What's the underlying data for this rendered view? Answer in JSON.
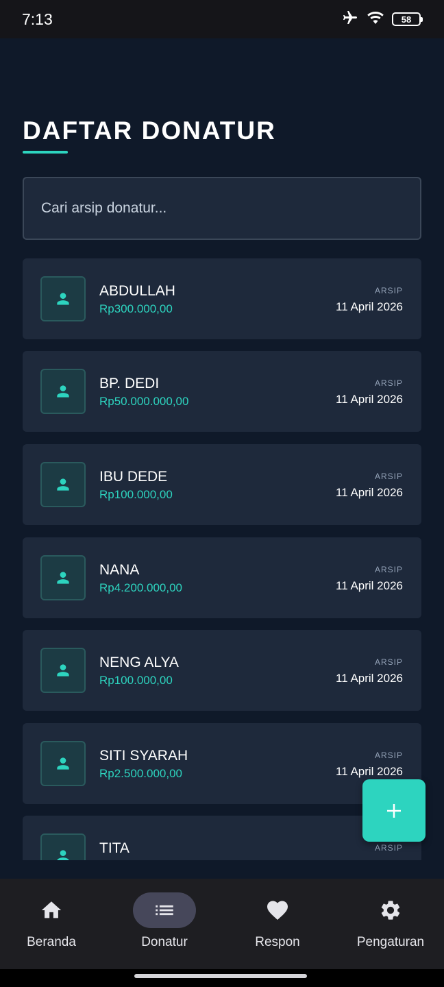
{
  "status_bar": {
    "time": "7:13",
    "battery": "58",
    "icons": [
      "airplane-icon",
      "wifi-icon",
      "battery-icon"
    ]
  },
  "page": {
    "title": "DAFTAR DONATUR",
    "accent_color": "#2dd4bf"
  },
  "search": {
    "placeholder": "Cari arsip donatur...",
    "value": ""
  },
  "donors": [
    {
      "name": "ABDULLAH",
      "amount": "Rp300.000,00",
      "label": "ARSIP",
      "date": "11 April 2026"
    },
    {
      "name": "BP. DEDI",
      "amount": "Rp50.000.000,00",
      "label": "ARSIP",
      "date": "11 April 2026"
    },
    {
      "name": "IBU DEDE",
      "amount": "Rp100.000,00",
      "label": "ARSIP",
      "date": "11 April 2026"
    },
    {
      "name": "NANA",
      "amount": "Rp4.200.000,00",
      "label": "ARSIP",
      "date": "11 April 2026"
    },
    {
      "name": "NENG ALYA",
      "amount": "Rp100.000,00",
      "label": "ARSIP",
      "date": "11 April 2026"
    },
    {
      "name": "SITI SYARAH",
      "amount": "Rp2.500.000,00",
      "label": "ARSIP",
      "date": "11 April 2026"
    },
    {
      "name": "TITA",
      "amount": "",
      "label": "ARSIP",
      "date": ""
    }
  ],
  "fab": {
    "icon": "plus-icon"
  },
  "bottom_nav": [
    {
      "label": "Beranda",
      "icon": "home-icon",
      "active": false
    },
    {
      "label": "Donatur",
      "icon": "list-icon",
      "active": true
    },
    {
      "label": "Respon",
      "icon": "heart-icon",
      "active": false
    },
    {
      "label": "Pengaturan",
      "icon": "gear-icon",
      "active": false
    }
  ]
}
